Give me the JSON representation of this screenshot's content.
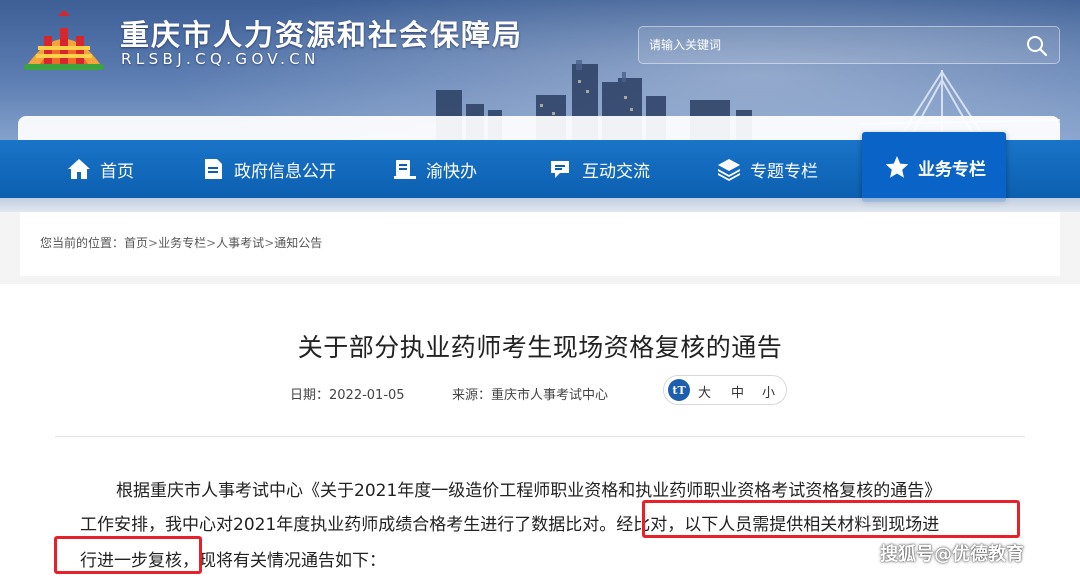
{
  "site": {
    "title": "重庆市人力资源和社会保障局",
    "domain": "RLSBJ.CQ.GOV.CN"
  },
  "search": {
    "placeholder": "请输入关键词"
  },
  "nav": {
    "items": [
      {
        "label": "首页",
        "icon": "home-icon"
      },
      {
        "label": "政府信息公开",
        "icon": "document-icon"
      },
      {
        "label": "渝快办",
        "icon": "service-icon"
      },
      {
        "label": "互动交流",
        "icon": "chat-icon"
      },
      {
        "label": "专题专栏",
        "icon": "layers-icon"
      },
      {
        "label": "业务专栏",
        "icon": "star-icon",
        "active": true
      }
    ]
  },
  "breadcrumb": {
    "prefix": "您当前的位置：",
    "items": [
      "首页",
      "业务专栏",
      "人事考试",
      "通知公告"
    ],
    "separator": ">"
  },
  "article": {
    "title": "关于部分执业药师考生现场资格复核的通告",
    "date": "日期：2022-01-05",
    "source": "来源：重庆市人事考试中心",
    "font_size": {
      "icon": "font-size-icon",
      "large": "大",
      "medium": "中",
      "small": "小"
    },
    "para1_line1": "根据重庆市人事考试中心《关于2021年度一级造价工程师职业资格和执业药师职业资格考试资格复核的通告》",
    "para1_line2_a": "工作安排，我中心对2021年度执业药师成绩合格考生进行了数据比对。",
    "para1_line2_b": "经比对，以下人员需提供相关材料到现场进",
    "para1_line3_a": "行进一步复核",
    "para1_line3_b": "，现将有关情况通告如下："
  },
  "watermark": "搜狐号@优德教育",
  "colors": {
    "nav": "#0c5fb0",
    "highlight": "#e8202a",
    "active_nav": "#0a63c6"
  }
}
